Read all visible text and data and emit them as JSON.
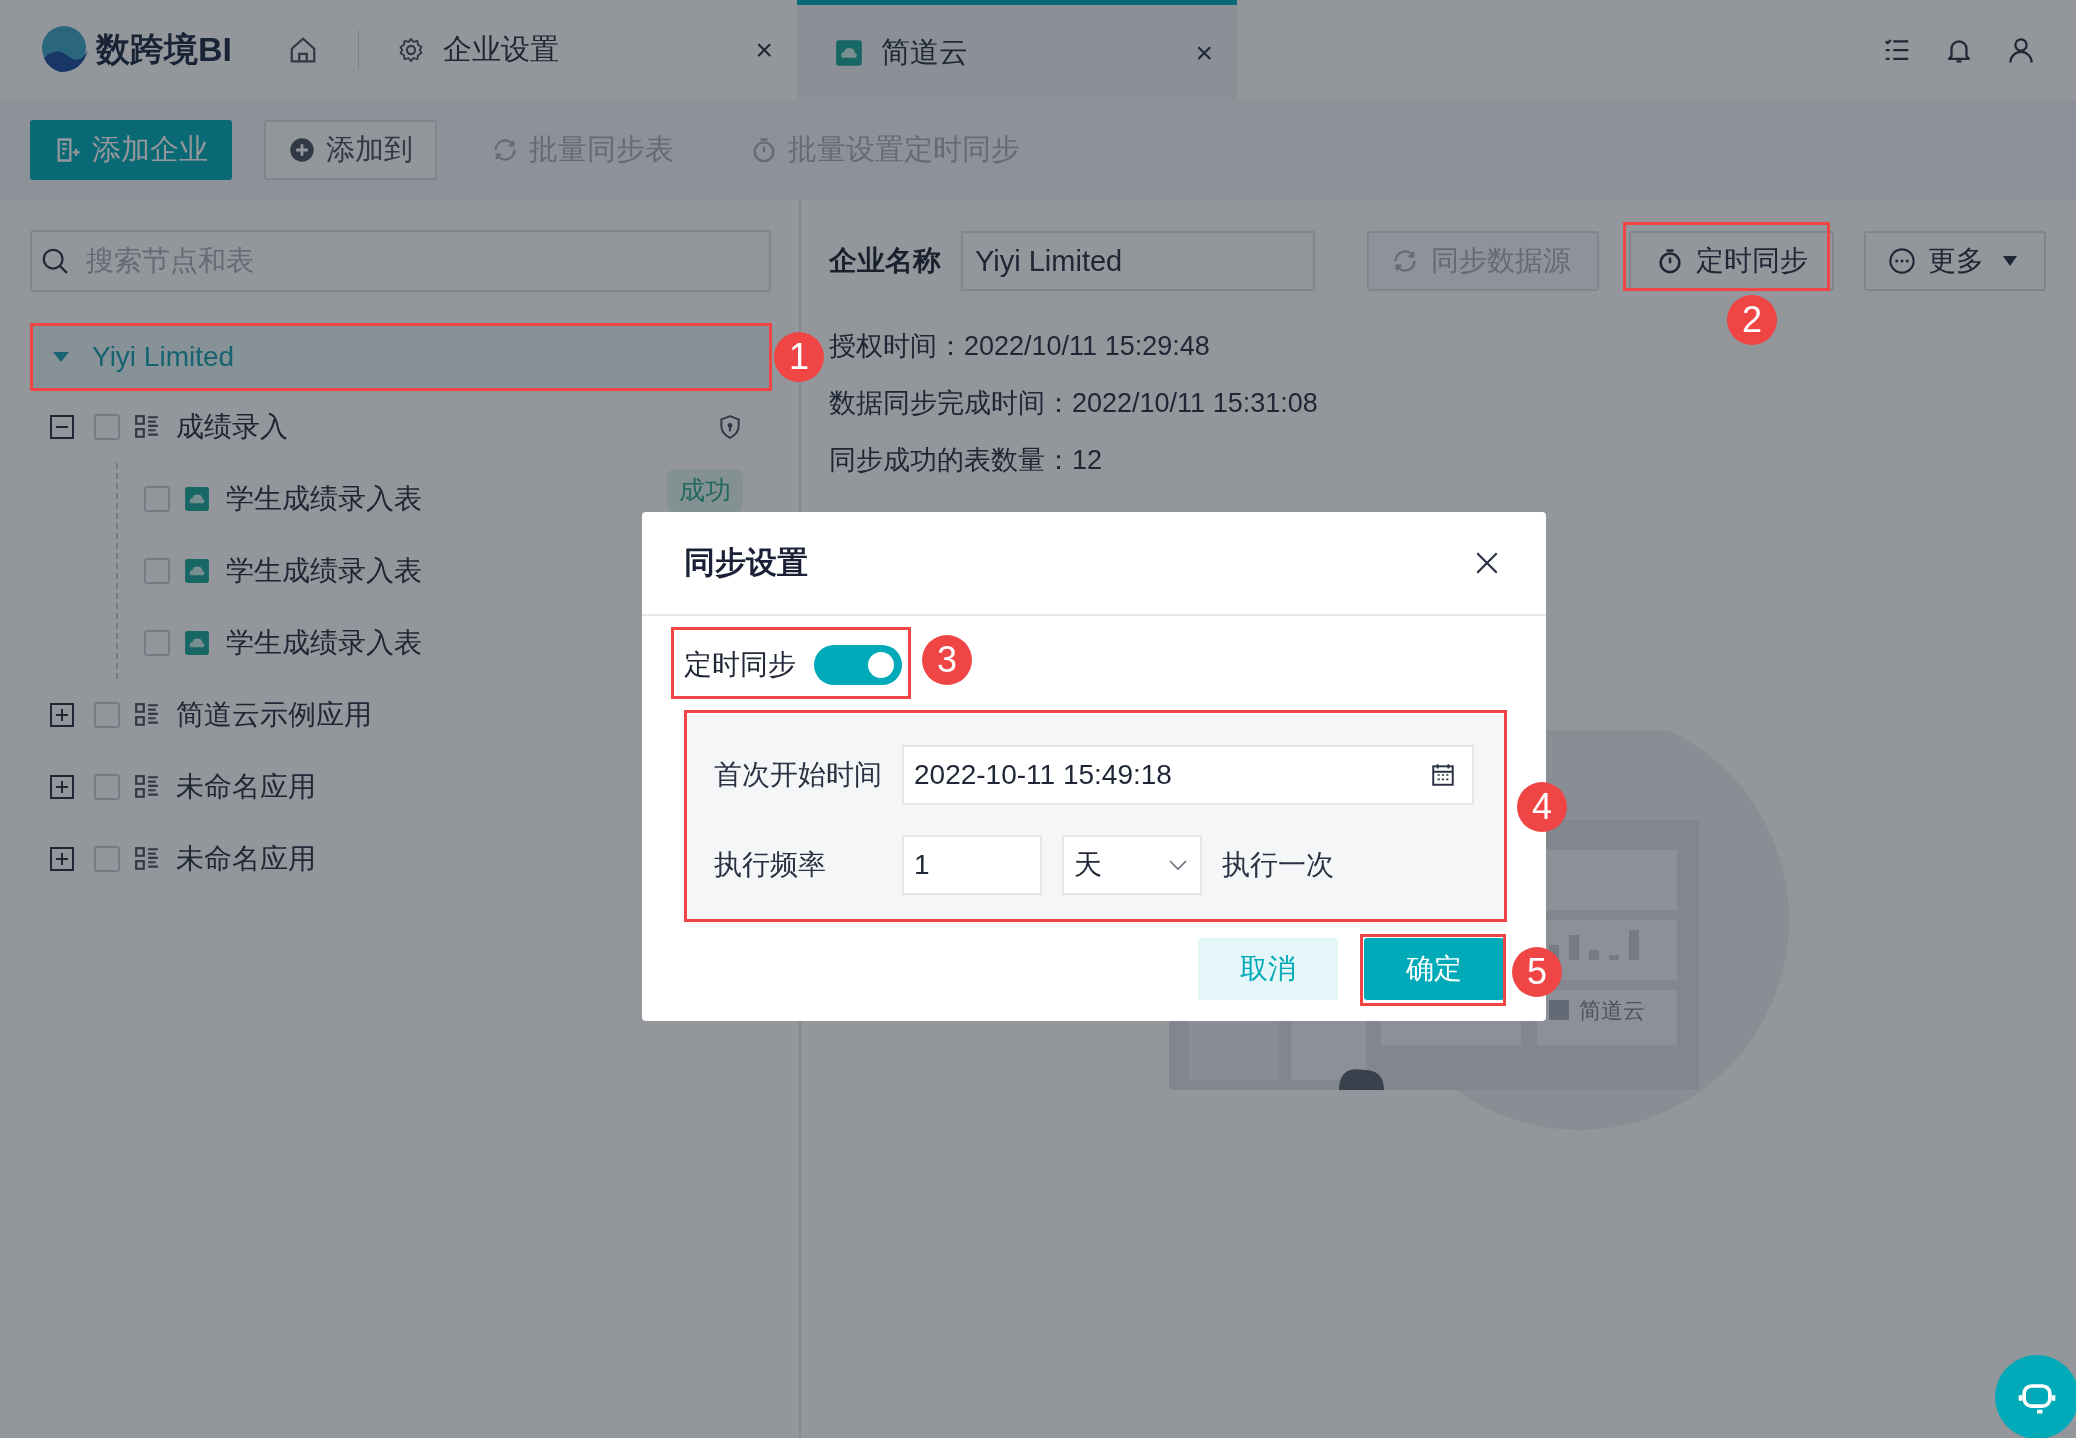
{
  "app": {
    "logo": "数跨境BI"
  },
  "tabs": [
    {
      "label": "企业设置",
      "selected": false,
      "close": "×"
    },
    {
      "label": "简道云",
      "selected": true,
      "close": "×"
    }
  ],
  "toolbar": [
    {
      "label": "添加企业",
      "kind": "primary",
      "disabled": false
    },
    {
      "label": "添加到",
      "kind": "outline",
      "disabled": false
    },
    {
      "label": "批量同步表",
      "kind": "text",
      "disabled": true
    },
    {
      "label": "批量设置定时同步",
      "kind": "text",
      "disabled": true
    }
  ],
  "search": {
    "placeholder": "搜索节点和表"
  },
  "tree": [
    {
      "label": "Yiyi Limited",
      "expanded": true,
      "selected": true,
      "children": [
        {
          "label": "成绩录入",
          "kind": "app",
          "expanded": true,
          "checked": false,
          "locked": true,
          "children": [
            {
              "label": "学生成绩录入表",
              "kind": "table",
              "checked": false,
              "status": "成功"
            },
            {
              "label": "学生成绩录入表",
              "kind": "table",
              "checked": false
            },
            {
              "label": "学生成绩录入表",
              "kind": "table",
              "checked": false
            }
          ]
        },
        {
          "label": "简道云示例应用",
          "kind": "app",
          "expanded": false,
          "checked": false
        },
        {
          "label": "未命名应用",
          "kind": "app",
          "expanded": false,
          "checked": false
        },
        {
          "label": "未命名应用",
          "kind": "app",
          "expanded": false,
          "checked": false
        }
      ]
    }
  ],
  "company": {
    "label": "企业名称",
    "value": "Yiyi Limited"
  },
  "actions": [
    {
      "label": "同步数据源",
      "disabled": true
    },
    {
      "label": "定时同步",
      "disabled": false
    },
    {
      "label": "更多",
      "disabled": false
    }
  ],
  "info": [
    "授权时间：2022/10/11 15:29:48",
    "数据同步完成时间：2022/10/11 15:31:08",
    "同步成功的表数量：12"
  ],
  "illustration": {
    "label": "简道云"
  },
  "dialog": {
    "title": "同步设置",
    "toggle": {
      "label": "定时同步",
      "on": true
    },
    "start": {
      "label": "首次开始时间",
      "value": "2022-10-11 15:49:18"
    },
    "frequency": {
      "label": "执行频率",
      "value": "1",
      "unit": "天",
      "suffix": "执行一次"
    },
    "buttons": [
      {
        "label": "取消",
        "kind": "secondary"
      },
      {
        "label": "确定",
        "kind": "primary"
      }
    ]
  },
  "annotations": [
    "1",
    "2",
    "3",
    "4",
    "5"
  ]
}
